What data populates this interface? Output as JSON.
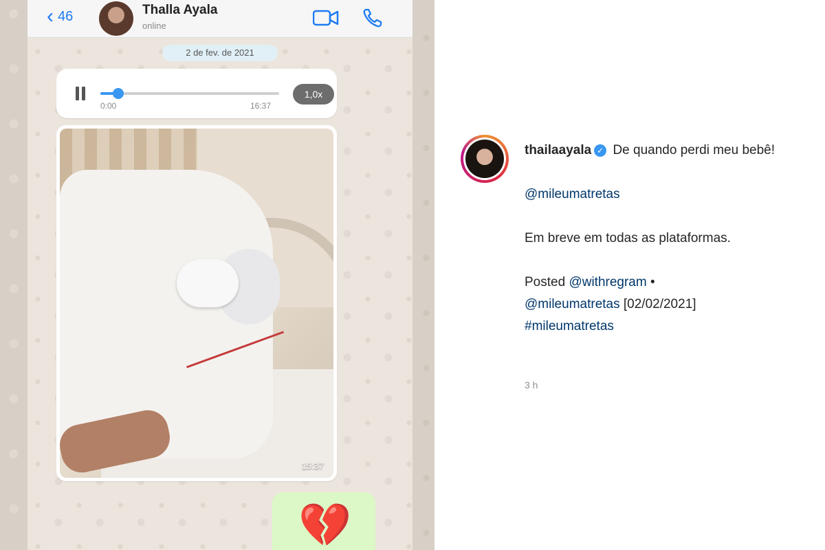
{
  "chat": {
    "back_icon": "chevron-left-icon",
    "unread_count": "46",
    "contact_name": "Thalla Ayala",
    "contact_status": "online",
    "date_label": "2 de fev. de 2021",
    "audio": {
      "current_time": "0:00",
      "duration": "16:37",
      "speed": "1,0x",
      "progress": 0.1
    },
    "photo_time": "15:37",
    "reaction_emoji": "💔",
    "video_icon": "video-camera-icon",
    "call_icon": "phone-icon"
  },
  "post": {
    "username": "thailaayala",
    "verified_icon": "verified-badge-icon",
    "caption_line1": "De quando perdi meu bebê!",
    "mention1": "@mileumatretas",
    "line2": "Em breve em todas as plataformas.",
    "posted_prefix": "Posted",
    "mention_withregram": "@withregram",
    "bullet": "•",
    "mention2": "@mileumatretas",
    "date_tag": "[02/02/2021]",
    "hashtag": "#mileumatretas",
    "time_ago": "3 h"
  },
  "colors": {
    "accent_blue": "#3897f0",
    "ios_blue": "#1e7bf2",
    "mention": "#00376b",
    "bubble_green": "#dcf8c6"
  }
}
